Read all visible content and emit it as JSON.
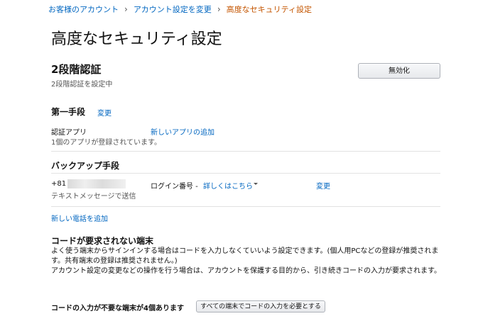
{
  "breadcrumb": {
    "items": [
      "お客様のアカウント",
      "アカウント設定を変更",
      "高度なセキュリティ設定"
    ],
    "separator": "›"
  },
  "page": {
    "title": "高度なセキュリティ設定"
  },
  "two_step": {
    "heading": "2段階認証",
    "status": "2段階認証を設定中",
    "disable_label": "無効化"
  },
  "primary_method": {
    "heading": "第一手段",
    "change_label": "変更",
    "type_label": "認証アプリ",
    "add_app_label": "新しいアプリの追加",
    "app_count_text": "1個のアプリが登録されています。"
  },
  "backup_method": {
    "heading": "バックアップ手段",
    "phone_prefix": "+81",
    "delivery_text": "テキストメッセージで送信",
    "login_code_label": "ログイン番号 -",
    "details_link": "詳しくはこちら",
    "change_label": "変更",
    "add_phone_label": "新しい電話を追加"
  },
  "trusted_devices": {
    "heading": "コードが要求されない端末",
    "desc_line1": "よく使う端末からサインインする場合はコードを入力しなくていいよう設定できます。(個人用PCなどの登録が推奨されます。共有端末の登録は推奨されません。)",
    "desc_line2": "アカウント設定の変更などの操作を行う場合は、アカウントを保護する目的から、引き続きコードの入力が要求されます。",
    "count_text": "コードの入力が不要な端末が4個あります",
    "require_all_label": "すべての端末でコードの入力を必要とする"
  },
  "colors": {
    "link": "#0066c0",
    "current_breadcrumb": "#c45500",
    "muted_text": "#555555",
    "divider": "#e2e2e2"
  }
}
